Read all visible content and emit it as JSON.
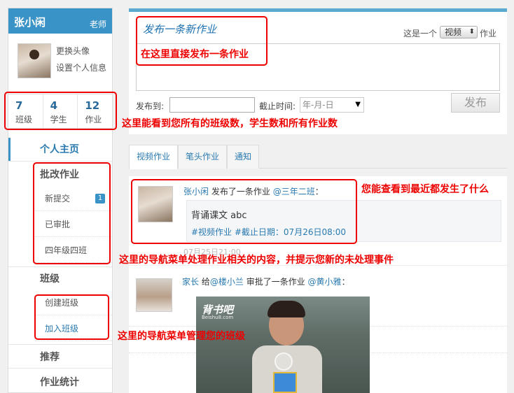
{
  "sidebar": {
    "user_name": "张小闲",
    "role": "老师",
    "change_avatar": "更换头像",
    "set_info": "设置个人信息",
    "stats": [
      {
        "num": "7",
        "label": "班级"
      },
      {
        "num": "4",
        "label": "学生"
      },
      {
        "num": "12",
        "label": "作业"
      }
    ],
    "nav_home": "个人主页",
    "nav_grade": "批改作业",
    "grade_items": [
      {
        "label": "新提交",
        "badge": "1"
      },
      {
        "label": "已审批"
      },
      {
        "label": "四年级四班"
      }
    ],
    "nav_class": "班级",
    "class_items": [
      {
        "label": "创建班级"
      },
      {
        "label": "加入班级"
      }
    ],
    "nav_recommend": "推荐",
    "nav_stats": "作业统计"
  },
  "compose": {
    "title": "发布一条新作业",
    "type_prefix": "这是一个",
    "type_value": "视频",
    "type_suffix": "作业",
    "publish_to_label": "发布到:",
    "deadline_label": "截止时间:",
    "deadline_placeholder": "年-月-日",
    "publish_button": "发布"
  },
  "tabs": [
    "视频作业",
    "笔头作业",
    "通知"
  ],
  "feed": {
    "item1": {
      "user": "张小闲",
      "action": "发布了一条作业",
      "target": "@三年二班",
      "colon": "：",
      "title": "背诵课文 abc",
      "tags": "#视频作业 #截止日期：07月26日08:00",
      "time": "07月25日21:00"
    },
    "item2": {
      "user": "家长",
      "give": "给",
      "student": "@楼小兰",
      "action": "审批了一条作业",
      "target": "@黄小雅",
      "colon": "：",
      "video_logo": "背书吧",
      "video_logo_sub": "Beishu8.com"
    }
  },
  "annotations": {
    "compose_note": "在这里直接发布一条作业",
    "stats_note": "这里能看到您所有的班级数，学生数和所有作业数",
    "feed_note": "您能查看到最近都发生了什么",
    "grade_note": "这里的导航菜单处理作业相关的内容，并提示您新的未处理事件",
    "class_note": "这里的导航菜单管理您的班级"
  },
  "colors": {
    "accent": "#3a93c6",
    "annotation": "#ee0000"
  }
}
